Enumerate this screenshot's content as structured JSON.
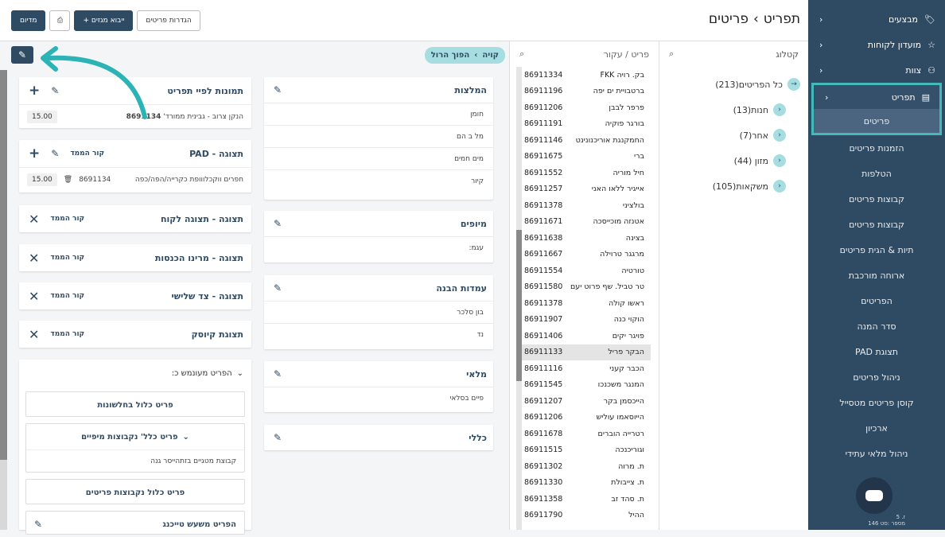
{
  "header": {
    "title_part1": "תפריט",
    "title_part2": "פריטים",
    "btn_settings": "הגדרות פריטים",
    "btn_import": "+ ייבוא מגזים",
    "btn_sync": "מדיום"
  },
  "sidebar": {
    "items": [
      {
        "label": "מבצעים",
        "icon": "tag-icon"
      },
      {
        "label": "מועדון לקוחות",
        "icon": "star-icon"
      },
      {
        "label": "צוות",
        "icon": "team-icon"
      }
    ],
    "active": {
      "label": "תפריט",
      "icon": "menu-icon",
      "sub": "פריטים"
    },
    "subitems": [
      "הזמנות פריטים",
      "הטלפות",
      "קבוצות פריטים",
      "קבוצות פריטים",
      "תיות & הגית פריטים",
      "ארוחה מורכבת",
      "הפריטים",
      "סדר המנה",
      "תצוגת PAD",
      "ניהול פריטים",
      "קוסן פריטים מטסייל",
      "ארכיון",
      "ניהול מלאי עתידי"
    ],
    "footer_line1": "ז. 5",
    "footer_line2": "מספר :סט 146"
  },
  "catalog": {
    "title": "קטלוג",
    "tree": [
      {
        "label": "כל הפריטים(213)",
        "level": 0
      },
      {
        "label": "חנות(13)",
        "level": 1
      },
      {
        "label": "אחר(7)",
        "level": 1
      },
      {
        "label": "מזון (44)",
        "level": 1
      },
      {
        "label": "משקאות(105)",
        "level": 1
      }
    ]
  },
  "items": {
    "search_placeholder": "פריט / עקור",
    "rows": [
      {
        "name": "בק. רויה FKK",
        "code": "86911334"
      },
      {
        "name": "ברטבויית ים יפה",
        "code": "86911196"
      },
      {
        "name": "פרפר לבבן",
        "code": "86911206"
      },
      {
        "name": "בורגר פוקיה",
        "code": "86911191"
      },
      {
        "name": "החמקנגת אוריכנונינט",
        "code": "86911146"
      },
      {
        "name": "ברי",
        "code": "86911675"
      },
      {
        "name": "חיל מוריה",
        "code": "86911552"
      },
      {
        "name": "אייגיר ללאו האני",
        "code": "86911257"
      },
      {
        "name": "בולציני",
        "code": "86911378"
      },
      {
        "name": "אטנזה מוכייסכה",
        "code": "86911671"
      },
      {
        "name": "בצינה",
        "code": "86911638"
      },
      {
        "name": "מרגגר טרוילה",
        "code": "86911667"
      },
      {
        "name": "טורטיה",
        "code": "86911554"
      },
      {
        "name": "טר טביל. שף פרוט יעם",
        "code": "86911580"
      },
      {
        "name": "ראשו קולה",
        "code": "86911378"
      },
      {
        "name": "הוקוי כנה",
        "code": "86911907"
      },
      {
        "name": "פויגר יקים",
        "code": "86911406"
      },
      {
        "name": "הבקר פריל",
        "code": "86911133",
        "selected": true
      },
      {
        "name": "הכבר קעני",
        "code": "86911116"
      },
      {
        "name": "המנגר משכנכו",
        "code": "86911545"
      },
      {
        "name": "הייכסמן בקר",
        "code": "86911207"
      },
      {
        "name": "הייוסאמו עוליש",
        "code": "86911206"
      },
      {
        "name": "רטרייה הוברים",
        "code": "86911678"
      },
      {
        "name": "וגוריכנכה",
        "code": "86911515"
      },
      {
        "name": "ת. מרוה",
        "code": "86911302"
      },
      {
        "name": "ת. צייבולת",
        "code": "86911330"
      },
      {
        "name": "ת. סהד זב",
        "code": "86911358"
      },
      {
        "name": "ההיל",
        "code": "86911790"
      }
    ]
  },
  "breadcrumb": {
    "part1": "קויה",
    "part2": "הפוך הרול"
  },
  "details": {
    "photo": {
      "title": "תמונות לפיי תפריט",
      "desc": "הנקן צרוב - גבינית ממורד'",
      "code": "8691134",
      "qty": "15.00"
    },
    "pad": {
      "title": "תצוגה - PAD",
      "link": "קור הממד",
      "desc": "חפרים ווקכלווופת כקרייה/הפה/כפה",
      "code": "8691134",
      "qty": "15.00"
    },
    "views": [
      {
        "title": "תצוגה - תצוגה לקוח",
        "link": "קור הממד"
      },
      {
        "title": "תצוגה - מרינו הכנסות",
        "link": "קור הממד"
      },
      {
        "title": "תצוגה - צד שלישי",
        "link": "קור הממד"
      },
      {
        "title": "תצוגת קיוסק",
        "link": "קור הממד"
      }
    ],
    "linked_title": "הפריט מעונמש כ:",
    "linked_cards": [
      {
        "title": "פריט כלול בחלשונות"
      },
      {
        "title": "פריט כלל' נקבוצות מיפיים",
        "sub": "קבוצת מטגיים בזתהייסר גנה"
      },
      {
        "title": "פריט כלול נקבוצות פריטים"
      },
      {
        "title": "הפריט משעש טייכנג"
      }
    ]
  },
  "groups": [
    {
      "title": "המלצות",
      "rows": [
        "חומן",
        "מל ב הם",
        "מים חמים",
        "קיור"
      ]
    },
    {
      "title": "מיופים",
      "rows": [
        "עגמ:"
      ]
    },
    {
      "title": "עמדות הבנה",
      "rows": [
        "בון סלכר",
        "נד"
      ]
    },
    {
      "title": "מלאי",
      "rows": [
        "פיים בסלאי"
      ]
    },
    {
      "title": "כללי",
      "rows": []
    }
  ]
}
